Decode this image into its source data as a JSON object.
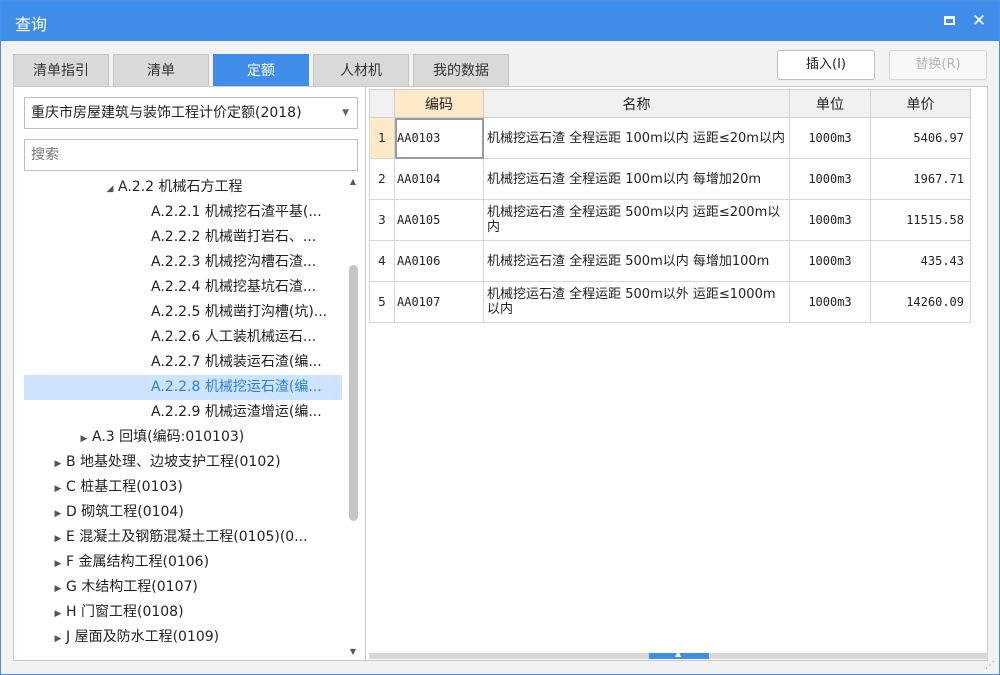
{
  "window": {
    "title": "查询"
  },
  "tabs": [
    {
      "label": "清单指引"
    },
    {
      "label": "清单"
    },
    {
      "label": "定额"
    },
    {
      "label": "人材机"
    },
    {
      "label": "我的数据"
    }
  ],
  "actions": {
    "insert": "插入(I)",
    "replace": "替换(R)"
  },
  "left": {
    "dropdown_value": "重庆市房屋建筑与装饰工程计价定额(2018)",
    "search_placeholder": "搜索",
    "tree": [
      {
        "label": "A.2.2 机械石方工程",
        "expanded": true
      },
      {
        "label": "A.2.2.1 机械挖石渣平基(..."
      },
      {
        "label": "A.2.2.2 机械凿打岩石、..."
      },
      {
        "label": "A.2.2.3 机械挖沟槽石渣..."
      },
      {
        "label": "A.2.2.4 机械挖基坑石渣..."
      },
      {
        "label": "A.2.2.5 机械凿打沟槽(坑)..."
      },
      {
        "label": "A.2.2.6 人工装机械运石..."
      },
      {
        "label": "A.2.2.7 机械装运石渣(编..."
      },
      {
        "label": "A.2.2.8 机械挖运石渣(编...",
        "selected": true
      },
      {
        "label": "A.2.2.9 机械运渣增运(编..."
      },
      {
        "label": "A.3 回填(编码:010103)"
      },
      {
        "label": "B 地基处理、边坡支护工程(0102)"
      },
      {
        "label": "C 桩基工程(0103)"
      },
      {
        "label": "D 砌筑工程(0104)"
      },
      {
        "label": "E 混凝土及钢筋混凝土工程(0105)(0..."
      },
      {
        "label": "F 金属结构工程(0106)"
      },
      {
        "label": "G 木结构工程(0107)"
      },
      {
        "label": "H 门窗工程(0108)"
      },
      {
        "label": "J 屋面及防水工程(0109)"
      }
    ]
  },
  "grid": {
    "headers": {
      "code": "编码",
      "name": "名称",
      "unit": "单位",
      "price": "单价"
    },
    "rows": [
      {
        "n": "1",
        "code": "AA0103",
        "name": "机械挖运石渣 全程运距 100m以内 运距≤20m以内",
        "unit": "1000m3",
        "price": "5406.97"
      },
      {
        "n": "2",
        "code": "AA0104",
        "name": "机械挖运石渣 全程运距 100m以内 每增加20m",
        "unit": "1000m3",
        "price": "1967.71"
      },
      {
        "n": "3",
        "code": "AA0105",
        "name": "机械挖运石渣 全程运距 500m以内 运距≤200m以内",
        "unit": "1000m3",
        "price": "11515.58"
      },
      {
        "n": "4",
        "code": "AA0106",
        "name": "机械挖运石渣 全程运距 500m以内 每增加100m",
        "unit": "1000m3",
        "price": "435.43"
      },
      {
        "n": "5",
        "code": "AA0107",
        "name": "机械挖运石渣 全程运距 500m以外 运距≤1000m以内",
        "unit": "1000m3",
        "price": "14260.09"
      }
    ]
  }
}
